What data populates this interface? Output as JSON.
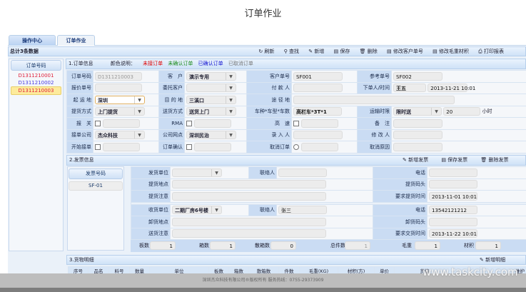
{
  "page_title": "订单作业",
  "tabs": [
    {
      "label": "操作中心"
    },
    {
      "label": "订单作业"
    }
  ],
  "toolbar": {
    "count": "总计3条数据",
    "buttons": [
      {
        "icon": "refresh-icon",
        "label": "刷新"
      },
      {
        "icon": "search-icon",
        "label": "查找"
      },
      {
        "icon": "add-icon",
        "label": "新增"
      },
      {
        "icon": "save-icon",
        "label": "保存"
      },
      {
        "icon": "delete-icon",
        "label": "删除"
      },
      {
        "icon": "edit-icon",
        "label": "修改客户单号"
      },
      {
        "icon": "edit-icon",
        "label": "修改毛重材积"
      },
      {
        "icon": "print-icon",
        "label": "打印报表"
      }
    ]
  },
  "orders": {
    "header": "订单号码",
    "items": [
      {
        "id": "D1311210001",
        "color": "#e0203a"
      },
      {
        "id": "D1311210002",
        "color": "#4b3de0"
      },
      {
        "id": "D1311210003",
        "color": "#e0203a",
        "selected": true
      }
    ]
  },
  "section1": {
    "title": "1.订单信息",
    "legend_label": "颜色说明：",
    "legend": [
      {
        "text": "未接订单",
        "color": "#e00000"
      },
      {
        "text": "未确认订单",
        "color": "#1a8a1a"
      },
      {
        "text": "已确认订单",
        "color": "#1010d0"
      },
      {
        "text": "已取消订单",
        "color": "#777777"
      }
    ],
    "labels": {
      "order_no": "订单号码",
      "customer": "客　户",
      "cust_no": "客户单号",
      "ref_no": "参考单号",
      "quote_no": "报价单号",
      "consign": "委托客户",
      "payer": "付 款 人",
      "placer": "下单人/时间",
      "origin": "起 运 地",
      "dest": "目 的 地",
      "via": "途 径 地",
      "pickup": "提货方式",
      "delivery": "送货方式",
      "vehicle": "车种*车型*车数",
      "transit": "运输时限",
      "customs": "报　关",
      "rma": "RMA",
      "highway": "高　速",
      "remark": "备　注",
      "company": "接单公司",
      "branch": "公司网点",
      "entry": "录 入 人",
      "modifier": "修 改 人",
      "start": "开始接单",
      "confirm": "订单确认",
      "cancel": "取消订单",
      "cancel_reason": "取消原因"
    },
    "values": {
      "order_no": "D1311210003",
      "customer": "演示专用",
      "cust_no": "SF001",
      "ref_no": "SF002",
      "placer": "王五",
      "placed_time": "2013-11-21 10:01",
      "origin": "深圳",
      "dest": "三溪口",
      "pickup": "上门提货",
      "delivery": "送货上门",
      "vehicle": "高栏车*3T*1",
      "transit": "限时送",
      "transit_hours": "20",
      "hours_unit": "小时",
      "company": "杰众科技",
      "branch": "深圳民治"
    }
  },
  "section2": {
    "title": "2.发票信息",
    "buttons": [
      {
        "label": "新增发票"
      },
      {
        "label": "保存发票"
      },
      {
        "label": "删除发票"
      }
    ],
    "invoice_header": "发票号码",
    "invoices": [
      "SF-01"
    ],
    "labels": {
      "ship_unit": "发货单位",
      "contact": "联络人",
      "phone": "电话",
      "pickup_addr": "提货地点",
      "pickup_dock": "提货码头",
      "pickup_note": "提货注意",
      "pickup_time": "要求提货时间",
      "recv_unit": "收货单位",
      "unload_addr": "卸货地点",
      "unload_dock": "卸货码头",
      "deliver_note": "送货注意",
      "deliver_time": "要求交货时间",
      "pallets": "板数",
      "boxes": "箱数",
      "loose": "散箱数",
      "total": "总件数",
      "weight": "毛重",
      "volume": "材积"
    },
    "values": {
      "pickup_time": "2013-11-01 10:01",
      "recv_unit": "二期厂房6号楼",
      "recv_contact": "张三",
      "recv_phone": "13542121212",
      "deliver_time": "2013-11-22 10:01",
      "pallets": "1",
      "boxes": "1",
      "loose": "0",
      "total": "1",
      "weight": "1",
      "volume": "1"
    }
  },
  "section3": {
    "title": "3.货物明细",
    "add_button": "新增明细",
    "columns": [
      "序号",
      "品名",
      "料号",
      "数量",
      "单位",
      "板数",
      "箱数",
      "散箱数",
      "件数",
      "毛重(KG)",
      "材积(方)",
      "单价",
      "货值",
      "维护"
    ]
  },
  "footer": "深圳杰众科技有限公司®版权所有  服务热线：0755-29373909",
  "watermark": "www.taskcity.com"
}
